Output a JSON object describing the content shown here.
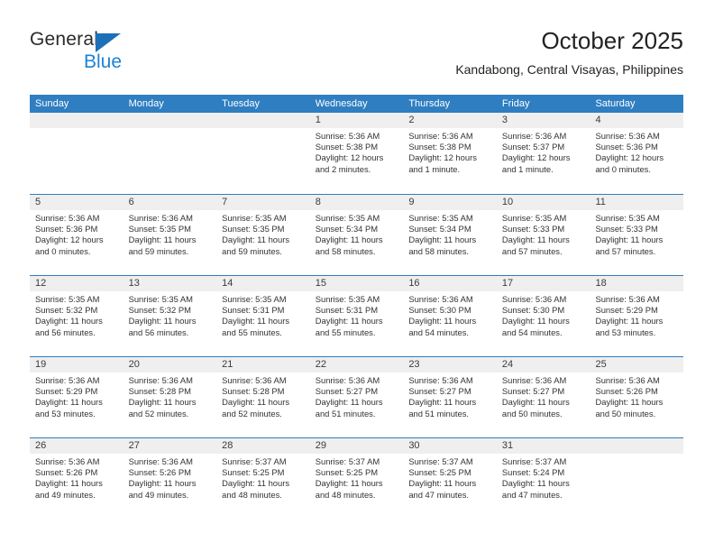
{
  "brand": {
    "name_part1": "General",
    "name_part2": "Blue",
    "triangle_icon": "triangle-icon",
    "accent_color": "#1d83d4"
  },
  "header": {
    "title": "October 2025",
    "subtitle": "Kandabong, Central Visayas, Philippines"
  },
  "theme": {
    "header_blue": "#2f7ec1",
    "band_gray": "#efefef",
    "text": "#333333"
  },
  "calendar": {
    "weekday_headers": [
      "Sunday",
      "Monday",
      "Tuesday",
      "Wednesday",
      "Thursday",
      "Friday",
      "Saturday"
    ],
    "weeks": [
      [
        {
          "day": "",
          "empty": true
        },
        {
          "day": "",
          "empty": true
        },
        {
          "day": "",
          "empty": true
        },
        {
          "day": "1",
          "sunrise": "Sunrise: 5:36 AM",
          "sunset": "Sunset: 5:38 PM",
          "daylight": "Daylight: 12 hours and 2 minutes."
        },
        {
          "day": "2",
          "sunrise": "Sunrise: 5:36 AM",
          "sunset": "Sunset: 5:38 PM",
          "daylight": "Daylight: 12 hours and 1 minute."
        },
        {
          "day": "3",
          "sunrise": "Sunrise: 5:36 AM",
          "sunset": "Sunset: 5:37 PM",
          "daylight": "Daylight: 12 hours and 1 minute."
        },
        {
          "day": "4",
          "sunrise": "Sunrise: 5:36 AM",
          "sunset": "Sunset: 5:36 PM",
          "daylight": "Daylight: 12 hours and 0 minutes."
        }
      ],
      [
        {
          "day": "5",
          "sunrise": "Sunrise: 5:36 AM",
          "sunset": "Sunset: 5:36 PM",
          "daylight": "Daylight: 12 hours and 0 minutes."
        },
        {
          "day": "6",
          "sunrise": "Sunrise: 5:36 AM",
          "sunset": "Sunset: 5:35 PM",
          "daylight": "Daylight: 11 hours and 59 minutes."
        },
        {
          "day": "7",
          "sunrise": "Sunrise: 5:35 AM",
          "sunset": "Sunset: 5:35 PM",
          "daylight": "Daylight: 11 hours and 59 minutes."
        },
        {
          "day": "8",
          "sunrise": "Sunrise: 5:35 AM",
          "sunset": "Sunset: 5:34 PM",
          "daylight": "Daylight: 11 hours and 58 minutes."
        },
        {
          "day": "9",
          "sunrise": "Sunrise: 5:35 AM",
          "sunset": "Sunset: 5:34 PM",
          "daylight": "Daylight: 11 hours and 58 minutes."
        },
        {
          "day": "10",
          "sunrise": "Sunrise: 5:35 AM",
          "sunset": "Sunset: 5:33 PM",
          "daylight": "Daylight: 11 hours and 57 minutes."
        },
        {
          "day": "11",
          "sunrise": "Sunrise: 5:35 AM",
          "sunset": "Sunset: 5:33 PM",
          "daylight": "Daylight: 11 hours and 57 minutes."
        }
      ],
      [
        {
          "day": "12",
          "sunrise": "Sunrise: 5:35 AM",
          "sunset": "Sunset: 5:32 PM",
          "daylight": "Daylight: 11 hours and 56 minutes."
        },
        {
          "day": "13",
          "sunrise": "Sunrise: 5:35 AM",
          "sunset": "Sunset: 5:32 PM",
          "daylight": "Daylight: 11 hours and 56 minutes."
        },
        {
          "day": "14",
          "sunrise": "Sunrise: 5:35 AM",
          "sunset": "Sunset: 5:31 PM",
          "daylight": "Daylight: 11 hours and 55 minutes."
        },
        {
          "day": "15",
          "sunrise": "Sunrise: 5:35 AM",
          "sunset": "Sunset: 5:31 PM",
          "daylight": "Daylight: 11 hours and 55 minutes."
        },
        {
          "day": "16",
          "sunrise": "Sunrise: 5:36 AM",
          "sunset": "Sunset: 5:30 PM",
          "daylight": "Daylight: 11 hours and 54 minutes."
        },
        {
          "day": "17",
          "sunrise": "Sunrise: 5:36 AM",
          "sunset": "Sunset: 5:30 PM",
          "daylight": "Daylight: 11 hours and 54 minutes."
        },
        {
          "day": "18",
          "sunrise": "Sunrise: 5:36 AM",
          "sunset": "Sunset: 5:29 PM",
          "daylight": "Daylight: 11 hours and 53 minutes."
        }
      ],
      [
        {
          "day": "19",
          "sunrise": "Sunrise: 5:36 AM",
          "sunset": "Sunset: 5:29 PM",
          "daylight": "Daylight: 11 hours and 53 minutes."
        },
        {
          "day": "20",
          "sunrise": "Sunrise: 5:36 AM",
          "sunset": "Sunset: 5:28 PM",
          "daylight": "Daylight: 11 hours and 52 minutes."
        },
        {
          "day": "21",
          "sunrise": "Sunrise: 5:36 AM",
          "sunset": "Sunset: 5:28 PM",
          "daylight": "Daylight: 11 hours and 52 minutes."
        },
        {
          "day": "22",
          "sunrise": "Sunrise: 5:36 AM",
          "sunset": "Sunset: 5:27 PM",
          "daylight": "Daylight: 11 hours and 51 minutes."
        },
        {
          "day": "23",
          "sunrise": "Sunrise: 5:36 AM",
          "sunset": "Sunset: 5:27 PM",
          "daylight": "Daylight: 11 hours and 51 minutes."
        },
        {
          "day": "24",
          "sunrise": "Sunrise: 5:36 AM",
          "sunset": "Sunset: 5:27 PM",
          "daylight": "Daylight: 11 hours and 50 minutes."
        },
        {
          "day": "25",
          "sunrise": "Sunrise: 5:36 AM",
          "sunset": "Sunset: 5:26 PM",
          "daylight": "Daylight: 11 hours and 50 minutes."
        }
      ],
      [
        {
          "day": "26",
          "sunrise": "Sunrise: 5:36 AM",
          "sunset": "Sunset: 5:26 PM",
          "daylight": "Daylight: 11 hours and 49 minutes."
        },
        {
          "day": "27",
          "sunrise": "Sunrise: 5:36 AM",
          "sunset": "Sunset: 5:26 PM",
          "daylight": "Daylight: 11 hours and 49 minutes."
        },
        {
          "day": "28",
          "sunrise": "Sunrise: 5:37 AM",
          "sunset": "Sunset: 5:25 PM",
          "daylight": "Daylight: 11 hours and 48 minutes."
        },
        {
          "day": "29",
          "sunrise": "Sunrise: 5:37 AM",
          "sunset": "Sunset: 5:25 PM",
          "daylight": "Daylight: 11 hours and 48 minutes."
        },
        {
          "day": "30",
          "sunrise": "Sunrise: 5:37 AM",
          "sunset": "Sunset: 5:25 PM",
          "daylight": "Daylight: 11 hours and 47 minutes."
        },
        {
          "day": "31",
          "sunrise": "Sunrise: 5:37 AM",
          "sunset": "Sunset: 5:24 PM",
          "daylight": "Daylight: 11 hours and 47 minutes."
        },
        {
          "day": "",
          "empty": true
        }
      ]
    ]
  }
}
